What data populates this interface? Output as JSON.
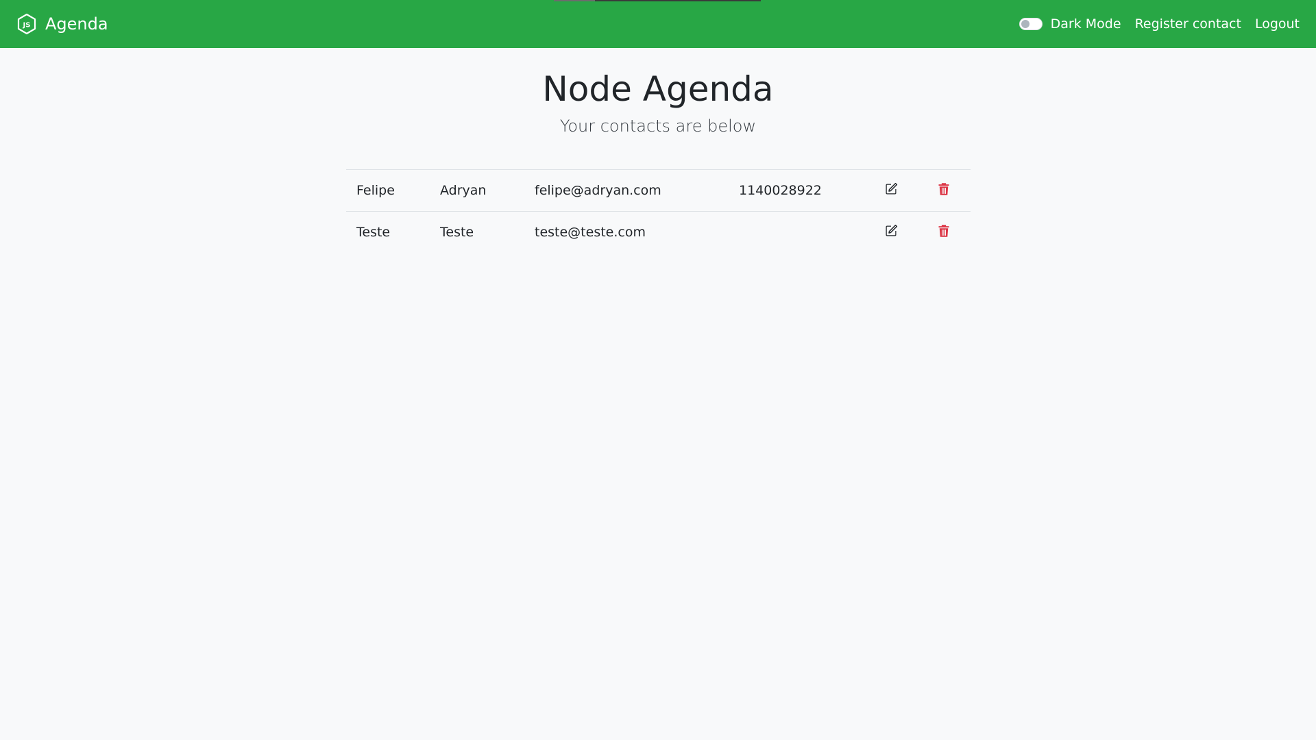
{
  "navbar": {
    "brand": "Agenda",
    "brand_icon": "nodejs-icon",
    "dark_mode_label": "Dark Mode",
    "register_label": "Register contact",
    "logout_label": "Logout",
    "background": "#28a745"
  },
  "main": {
    "title": "Node Agenda",
    "subtitle": "Your contacts are below"
  },
  "contacts": [
    {
      "first_name": "Felipe",
      "last_name": "Adryan",
      "email": "felipe@adryan.com",
      "phone": "1140028922"
    },
    {
      "first_name": "Teste",
      "last_name": "Teste",
      "email": "teste@teste.com",
      "phone": ""
    }
  ],
  "icons": {
    "edit": "edit-icon",
    "delete": "trash-icon"
  },
  "colors": {
    "danger": "#dc3545",
    "accent": "#28a745"
  }
}
